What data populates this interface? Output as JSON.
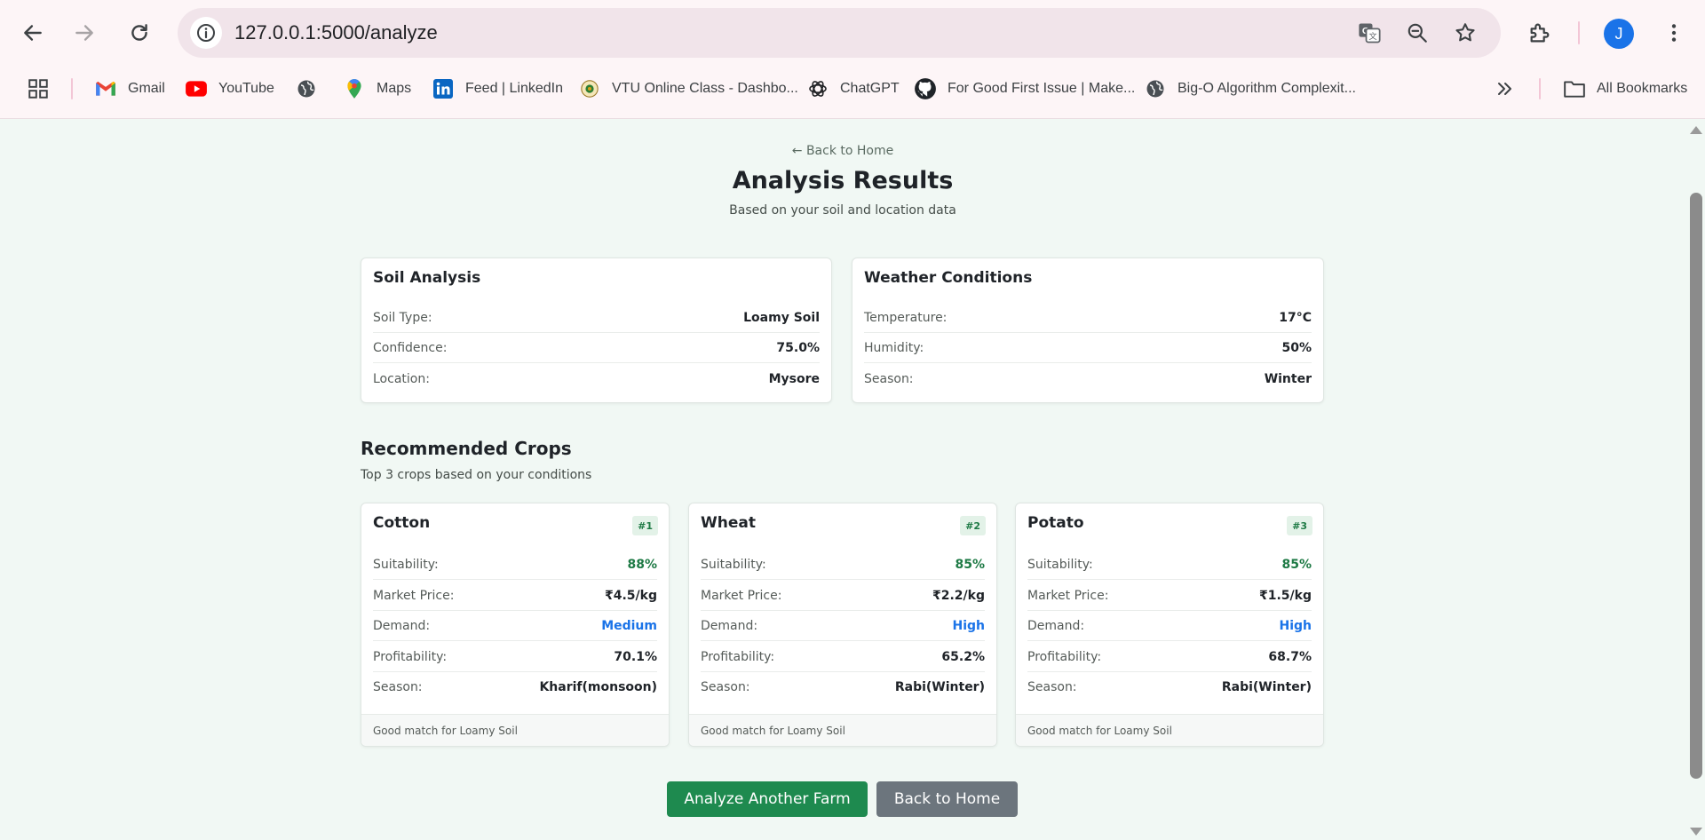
{
  "browser": {
    "url": "127.0.0.1:5000/analyze",
    "profile_initial": "J",
    "bookmarks": [
      {
        "label": "Gmail",
        "icon": "gmail-icon"
      },
      {
        "label": "YouTube",
        "icon": "youtube-icon"
      },
      {
        "label": "",
        "icon": "globe-icon"
      },
      {
        "label": "Maps",
        "icon": "maps-icon"
      },
      {
        "label": "Feed | LinkedIn",
        "icon": "linkedin-icon"
      },
      {
        "label": "VTU Online Class - Dashbo...",
        "icon": "vtu-icon"
      },
      {
        "label": "ChatGPT",
        "icon": "chatgpt-icon"
      },
      {
        "label": "For Good First Issue | Make...",
        "icon": "github-icon"
      },
      {
        "label": "Big-O Algorithm Complexit...",
        "icon": "globe-icon"
      }
    ],
    "all_bookmarks_label": "All Bookmarks",
    "accent_color": "#1a73e8"
  },
  "page": {
    "back_link": "← Back to Home",
    "title": "Analysis Results",
    "subtitle": "Based on your soil and location data"
  },
  "soil": {
    "title": "Soil Analysis",
    "rows": [
      {
        "label": "Soil Type:",
        "value": "Loamy Soil"
      },
      {
        "label": "Confidence:",
        "value": "75.0%"
      },
      {
        "label": "Location:",
        "value": "Mysore"
      }
    ]
  },
  "weather": {
    "title": "Weather Conditions",
    "rows": [
      {
        "label": "Temperature:",
        "value": "17°C"
      },
      {
        "label": "Humidity:",
        "value": "50%"
      },
      {
        "label": "Season:",
        "value": "Winter"
      }
    ]
  },
  "recommendations": {
    "title": "Recommended Crops",
    "subtitle": "Top 3 crops based on your conditions",
    "crops": [
      {
        "name": "Cotton",
        "rank": "#1",
        "rows": [
          {
            "label": "Suitability:",
            "value": "88%"
          },
          {
            "label": "Market Price:",
            "value": "₹4.5/kg"
          },
          {
            "label": "Demand:",
            "value": "Medium"
          },
          {
            "label": "Profitability:",
            "value": "70.1%"
          },
          {
            "label": "Season:",
            "value": "Kharif(monsoon)"
          }
        ],
        "footer": "Good match for Loamy Soil"
      },
      {
        "name": "Wheat",
        "rank": "#2",
        "rows": [
          {
            "label": "Suitability:",
            "value": "85%"
          },
          {
            "label": "Market Price:",
            "value": "₹2.2/kg"
          },
          {
            "label": "Demand:",
            "value": "High"
          },
          {
            "label": "Profitability:",
            "value": "65.2%"
          },
          {
            "label": "Season:",
            "value": "Rabi(Winter)"
          }
        ],
        "footer": "Good match for Loamy Soil"
      },
      {
        "name": "Potato",
        "rank": "#3",
        "rows": [
          {
            "label": "Suitability:",
            "value": "85%"
          },
          {
            "label": "Market Price:",
            "value": "₹1.5/kg"
          },
          {
            "label": "Demand:",
            "value": "High"
          },
          {
            "label": "Profitability:",
            "value": "68.7%"
          },
          {
            "label": "Season:",
            "value": "Rabi(Winter)"
          }
        ],
        "footer": "Good match for Loamy Soil"
      }
    ]
  },
  "actions": {
    "analyze_another": "Analyze Another Farm",
    "back_home": "Back to Home"
  },
  "colors": {
    "primary_green": "#1e8a4f",
    "suitability_green": "#1e7a45",
    "demand_blue": "#1a73e8",
    "secondary_gray": "#6c757d",
    "page_background": "#f1f8f4"
  }
}
